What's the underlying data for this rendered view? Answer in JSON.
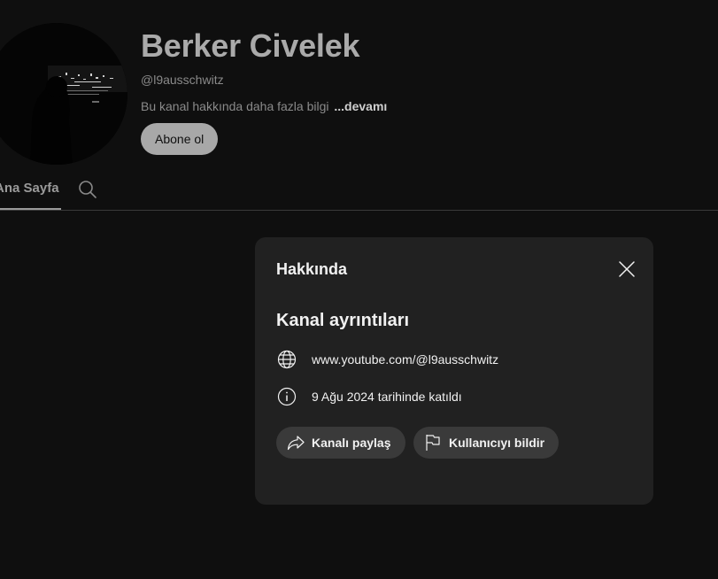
{
  "channel": {
    "name": "Berker Civelek",
    "handle": "@l9ausschwitz",
    "about_text": "Bu kanal hakkında daha fazla bilgi",
    "about_more": "...devamı",
    "subscribe_label": "Abone ol"
  },
  "tabs": {
    "home_label": "Ana Sayfa",
    "search_icon": "search-icon"
  },
  "about_dialog": {
    "title": "Hakkında",
    "section_title": "Kanal ayrıntıları",
    "url": "www.youtube.com/@l9ausschwitz",
    "joined": "9 Ağu 2024 tarihinde katıldı",
    "share_label": "Kanalı paylaş",
    "report_label": "Kullanıcıyı bildir",
    "icons": [
      "globe-icon",
      "info-icon",
      "share-icon",
      "flag-icon",
      "close-icon"
    ]
  },
  "colors": {
    "background": "#0f0f0f",
    "dialog": "#212121",
    "pill": "#3a3a3a",
    "subscribe": "#a8a8a8"
  }
}
